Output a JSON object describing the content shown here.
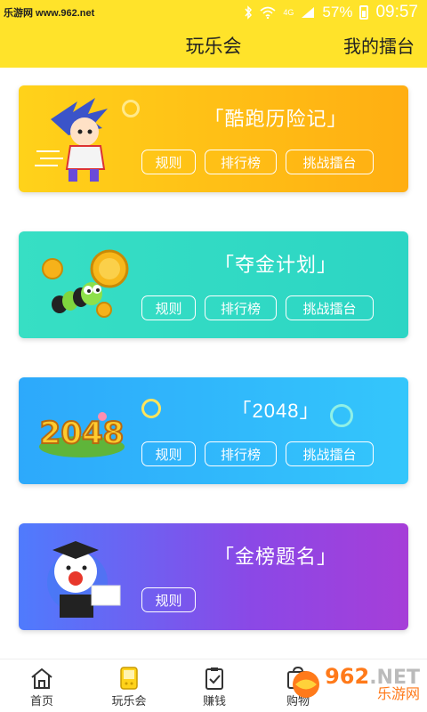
{
  "status_bar": {
    "source_text": "乐游网 www.962.net",
    "signal": "4G",
    "battery": "57%",
    "time": "09:57"
  },
  "header": {
    "title": "玩乐会",
    "right_link": "我的擂台"
  },
  "cards": [
    {
      "title": "「酷跑历险记」",
      "buttons": [
        "规则",
        "排行榜",
        "挑战擂台"
      ]
    },
    {
      "title": "「夺金计划」",
      "buttons": [
        "规则",
        "排行榜",
        "挑战擂台"
      ]
    },
    {
      "title": "「2048」",
      "buttons": [
        "规则",
        "排行榜",
        "挑战擂台"
      ]
    },
    {
      "title": "「金榜题名」",
      "buttons": [
        "规则"
      ]
    }
  ],
  "card_art_text": {
    "game_2048": "2048"
  },
  "bottom_nav": [
    {
      "label": "首页",
      "icon": "home-icon"
    },
    {
      "label": "玩乐会",
      "icon": "game-console-icon"
    },
    {
      "label": "赚钱",
      "icon": "clipboard-check-icon"
    },
    {
      "label": "购物",
      "icon": "shopping-icon"
    }
  ],
  "watermark": {
    "number": "962",
    "suffix": ".NET",
    "sub": "乐游网"
  },
  "colors": {
    "accent": "#ffe32a",
    "card1": "#ffb814",
    "card2": "#30d9c4",
    "card3": "#30b6fb",
    "card4": "#8b48e6"
  }
}
